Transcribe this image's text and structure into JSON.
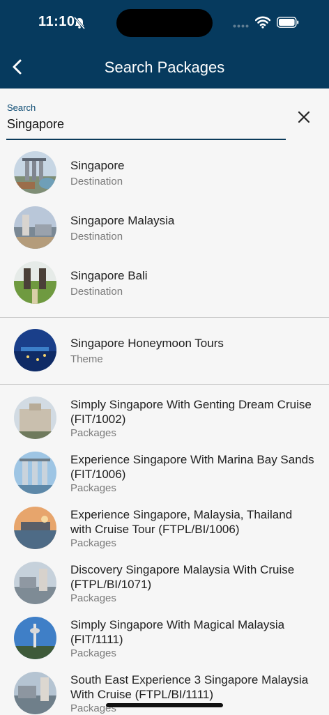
{
  "status": {
    "time": "11:10"
  },
  "header": {
    "title": "Search Packages"
  },
  "search": {
    "label": "Search",
    "value": "Singapore"
  },
  "results": [
    {
      "title": "Singapore",
      "type": "Destination"
    },
    {
      "title": "Singapore Malaysia",
      "type": "Destination"
    },
    {
      "title": "Singapore Bali",
      "type": "Destination"
    },
    {
      "title": "Singapore Honeymoon Tours",
      "type": "Theme"
    },
    {
      "title": "Simply Singapore With Genting Dream Cruise (FIT/1002)",
      "type": "Packages"
    },
    {
      "title": "Experience Singapore With Marina Bay Sands (FIT/1006)",
      "type": "Packages"
    },
    {
      "title": "Experience Singapore, Malaysia, Thailand with Cruise Tour  (FTPL/BI/1006)",
      "type": "Packages"
    },
    {
      "title": "Discovery Singapore Malaysia With Cruise (FTPL/BI/1071)",
      "type": "Packages"
    },
    {
      "title": "Simply Singapore With Magical Malaysia (FIT/1111)",
      "type": "Packages"
    },
    {
      "title": "South East Experience 3 Singapore Malaysia With Cruise (FTPL/BI/1111)",
      "type": "Packages"
    }
  ],
  "colors": {
    "header_bg": "#063a5e",
    "accent": "#0b4a72"
  }
}
